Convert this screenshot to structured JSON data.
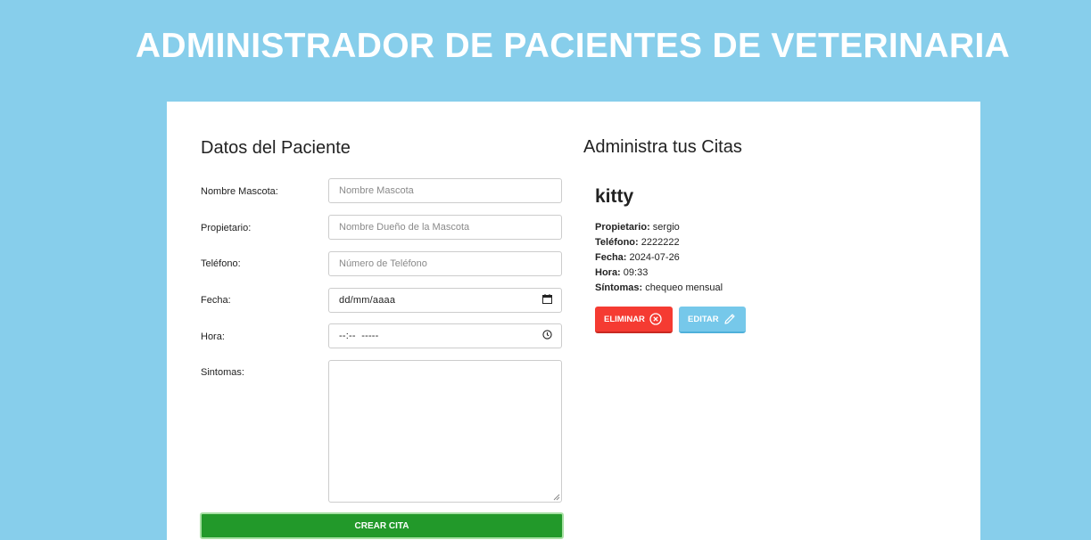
{
  "app_title": "ADMINISTRADOR DE PACIENTES DE VETERINARIA",
  "form": {
    "title": "Datos del Paciente",
    "fields": [
      {
        "label": "Nombre Mascota:",
        "placeholder": "Nombre Mascota"
      },
      {
        "label": "Propietario:",
        "placeholder": "Nombre Dueño de la Mascota"
      },
      {
        "label": "Teléfono:",
        "placeholder": "Número de Teléfono"
      },
      {
        "label": "Fecha:",
        "value": "dd/mm/aaaa",
        "icon": "calendar-icon"
      },
      {
        "label": "Hora:",
        "value": "--:--  -----",
        "icon": "clock-icon"
      },
      {
        "label": "Sintomas:"
      }
    ],
    "submit_label": "CREAR CITA"
  },
  "appointments": {
    "title": "Administra tus Citas",
    "items": [
      {
        "pet": "kitty",
        "owner_label": "Propietario:",
        "owner": "sergio",
        "phone_label": "Teléfono:",
        "phone": "2222222",
        "date_label": "Fecha:",
        "date": "2024-07-26",
        "time_label": "Hora:",
        "time": "09:33",
        "symptoms_label": "Síntomas:",
        "symptoms": "chequeo mensual",
        "delete_label": "ELIMINAR",
        "edit_label": "EDITAR"
      }
    ]
  },
  "colors": {
    "background": "#87ceeb",
    "submit": "#22992a",
    "delete": "#f53b32",
    "edit": "#76c8ea"
  }
}
